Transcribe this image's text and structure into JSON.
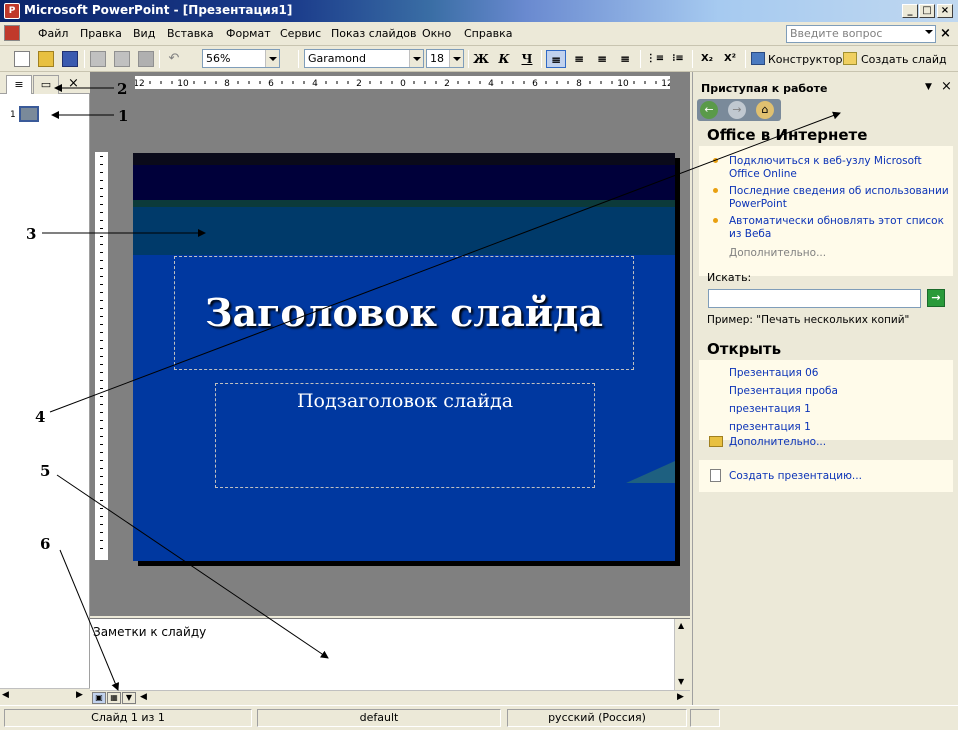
{
  "window": {
    "title": "Microsoft PowerPoint - [Презентация1]",
    "app_icon": "powerpoint-icon",
    "accent": "#0a246a"
  },
  "menu": {
    "items": [
      "Файл",
      "Правка",
      "Вид",
      "Вставка",
      "Формат",
      "Сервис",
      "Показ слайдов",
      "Окно",
      "Справка"
    ],
    "help_placeholder": "Введите вопрос",
    "close": "×"
  },
  "toolbar": {
    "zoom": "56%",
    "font": "Garamond",
    "font_size": "18",
    "bold": "Ж",
    "italic": "К",
    "underline": "Ч",
    "subscript": "X₂",
    "superscript": "X²",
    "designer_label": "Конструктор",
    "new_slide_label": "Создать слайд"
  },
  "left_pane": {
    "close": "×",
    "slide_number": "1"
  },
  "ruler": {
    "labels": [
      "12",
      "10",
      "8",
      "6",
      "4",
      "2",
      "0",
      "2",
      "4",
      "6",
      "8",
      "10",
      "12"
    ]
  },
  "slide": {
    "title": "Заголовок слайда",
    "subtitle": "Подзаголовок слайда",
    "background": "#0038a0"
  },
  "notes": {
    "placeholder": "Заметки к слайду"
  },
  "task_pane": {
    "title": "Приступая к работе",
    "close": "×",
    "office_online": {
      "heading": "Office в Интернете",
      "links": [
        "Подключиться к веб-узлу Microsoft Office Online",
        "Последние сведения об использовании PowerPoint",
        "Автоматически обновлять этот список из Веба"
      ],
      "more": "Дополнительно...",
      "search_label": "Искать:",
      "example": "Пример:  \"Печать нескольких копий\""
    },
    "open": {
      "heading": "Открыть",
      "files": [
        "Презентация 06",
        "Презентация проба",
        "презентация 1",
        "презентация 1"
      ],
      "more": "Дополнительно...",
      "create": "Создать презентацию..."
    }
  },
  "status": {
    "slide": "Слайд 1 из 1",
    "design": "default",
    "language": "русский (Россия)"
  },
  "annotations": [
    "1",
    "1",
    "2",
    "3",
    "4",
    "5",
    "6"
  ]
}
